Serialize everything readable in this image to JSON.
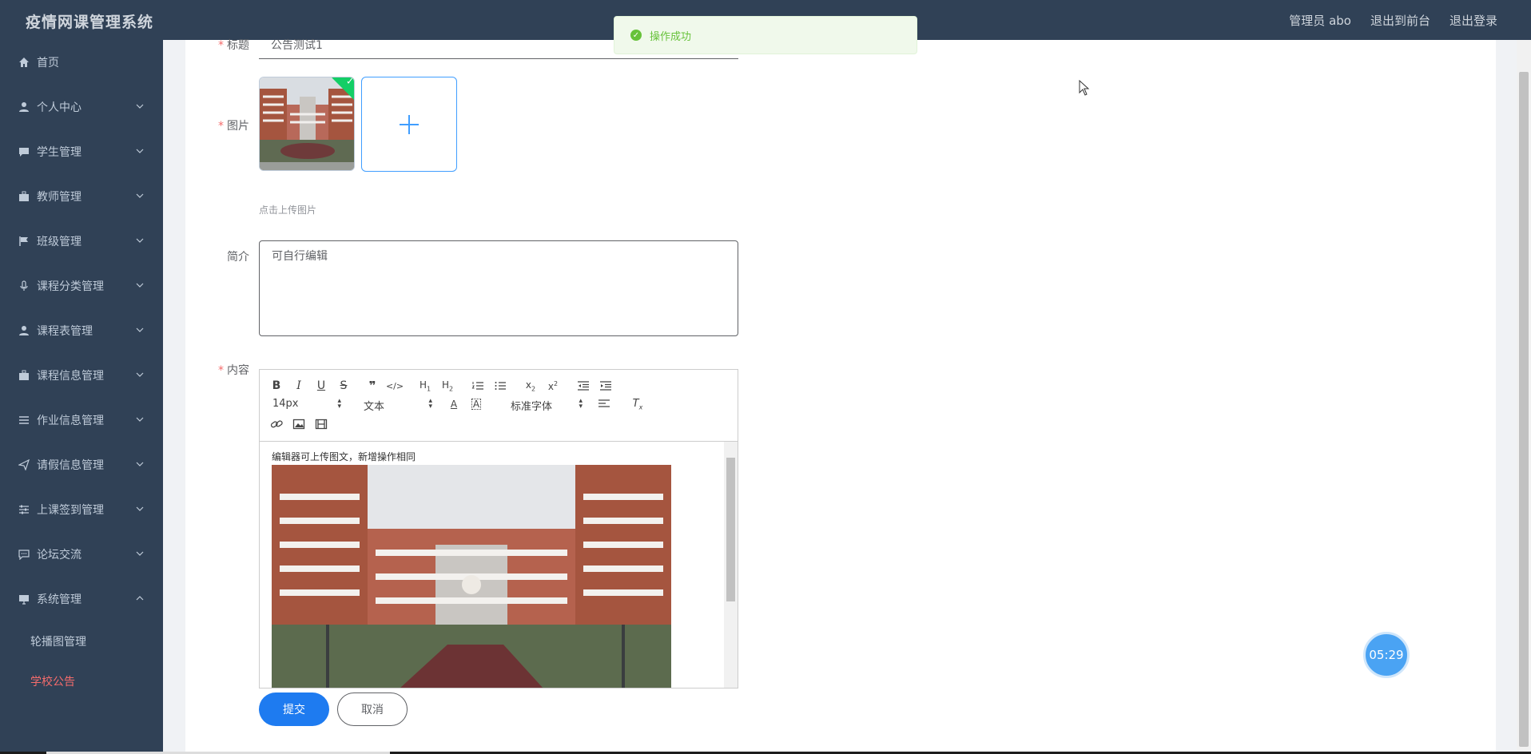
{
  "app": {
    "title": "疫情网课管理系统"
  },
  "header": {
    "user": "管理员 abo",
    "to_front": "退出到前台",
    "logout": "退出登录"
  },
  "sidebar": {
    "items": [
      {
        "label": "首页",
        "icon": "home-icon"
      },
      {
        "label": "个人中心",
        "icon": "user-icon"
      },
      {
        "label": "学生管理",
        "icon": "chat-icon"
      },
      {
        "label": "教师管理",
        "icon": "briefcase-icon"
      },
      {
        "label": "班级管理",
        "icon": "flag-icon"
      },
      {
        "label": "课程分类管理",
        "icon": "microphone-icon"
      },
      {
        "label": "课程表管理",
        "icon": "user-icon"
      },
      {
        "label": "课程信息管理",
        "icon": "briefcase-icon"
      },
      {
        "label": "作业信息管理",
        "icon": "list-icon"
      },
      {
        "label": "请假信息管理",
        "icon": "send-icon"
      },
      {
        "label": "上课签到管理",
        "icon": "sliders-icon"
      },
      {
        "label": "论坛交流",
        "icon": "comment-icon"
      },
      {
        "label": "系统管理",
        "icon": "monitor-icon"
      }
    ],
    "sub_items": [
      {
        "label": "轮播图管理"
      },
      {
        "label": "学校公告",
        "active": true
      }
    ]
  },
  "form": {
    "title_label": "标题",
    "title_value": "公告测试1",
    "image_label": "图片",
    "upload_tip": "点击上传图片",
    "intro_label": "简介",
    "intro_value": "可自行编辑",
    "content_label": "内容",
    "editor": {
      "font_size": "14px",
      "heading": "文本",
      "font_family": "标准字体",
      "body_text": "编辑器可上传图文，新增操作相同"
    },
    "submit": "提交",
    "cancel": "取消"
  },
  "toast": {
    "message": "操作成功"
  },
  "timer": {
    "value": "05:29"
  }
}
